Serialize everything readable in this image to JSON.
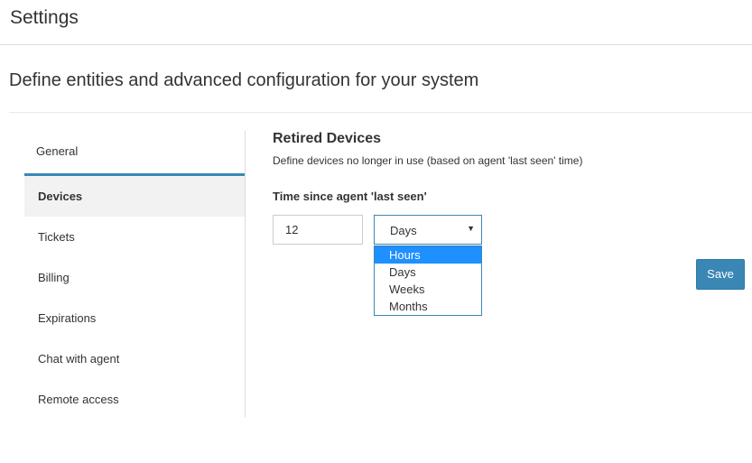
{
  "header": {
    "title": "Settings"
  },
  "subtitle": "Define entities and advanced configuration for your system",
  "sidebar": {
    "items": [
      {
        "label": "General"
      },
      {
        "label": "Devices"
      },
      {
        "label": "Tickets"
      },
      {
        "label": "Billing"
      },
      {
        "label": "Expirations"
      },
      {
        "label": "Chat with agent"
      },
      {
        "label": "Remote access"
      }
    ],
    "active": "Devices"
  },
  "main": {
    "section_title": "Retired Devices",
    "section_desc": "Define devices no longer in use (based on agent 'last seen' time)",
    "field_label": "Time since agent 'last seen'",
    "number_value": "12",
    "unit_select": {
      "selected": "Days",
      "options": [
        "Hours",
        "Days",
        "Weeks",
        "Months"
      ],
      "highlighted": "Hours"
    },
    "save_label": "Save"
  },
  "colors": {
    "accent": "#3a87b5",
    "highlight": "#1e90ff"
  },
  "icons": {
    "select_caret": "caret-down-icon"
  }
}
